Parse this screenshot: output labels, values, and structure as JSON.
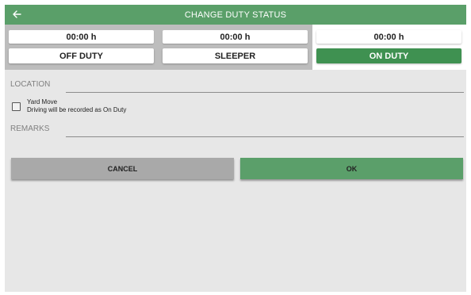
{
  "header": {
    "title": "CHANGE DUTY STATUS",
    "back_icon": "arrow-left-icon"
  },
  "statuses": [
    {
      "time": "00:00 h",
      "label": "OFF DUTY",
      "active": false
    },
    {
      "time": "00:00 h",
      "label": "SLEEPER",
      "active": false
    },
    {
      "time": "00:00 h",
      "label": "ON DUTY",
      "active": true
    }
  ],
  "form": {
    "location_label": "LOCATION",
    "location_value": "",
    "yard_move_label": "Yard Move",
    "yard_move_hint": "Driving will be recorded as On Duty",
    "yard_move_checked": false,
    "remarks_label": "REMARKS",
    "remarks_value": ""
  },
  "actions": {
    "cancel_label": "CANCEL",
    "ok_label": "OK"
  },
  "colors": {
    "primary": "#5a9f69",
    "active_status": "#3f9151",
    "cancel": "#a9a9a9",
    "background": "#e7e7e7"
  }
}
